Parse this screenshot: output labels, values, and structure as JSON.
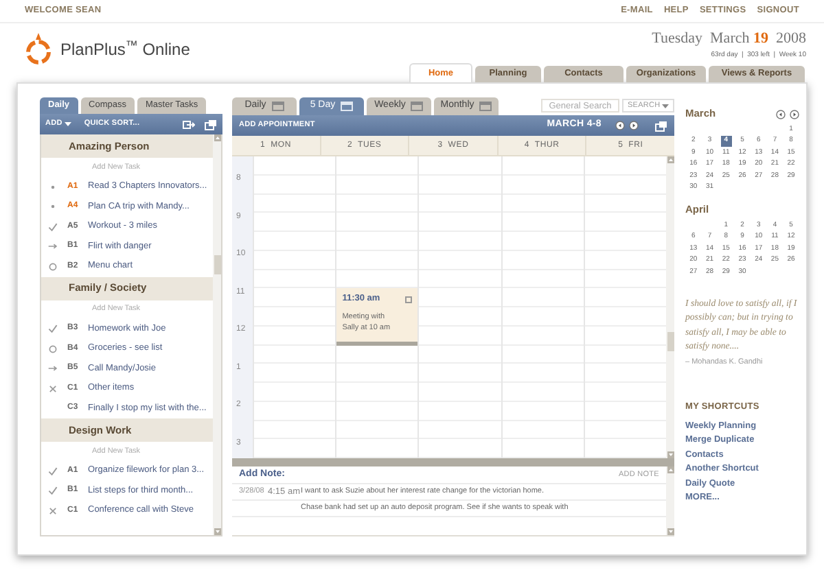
{
  "top_bar": {
    "welcome": "WELCOME SEAN",
    "links": [
      "E-MAIL",
      "HELP",
      "SETTINGS",
      "SIGNOUT"
    ]
  },
  "logo": {
    "text": "PlanPlus$^{™}$ Online"
  },
  "date": {
    "weekday": "Tuesday",
    "month": "March",
    "day": "19",
    "year": "2008",
    "info": "63rd day  |  303 left  |  Week 10"
  },
  "main_tabs": [
    {
      "label": "Home",
      "selected": true
    },
    {
      "label": "Planning",
      "selected": false
    },
    {
      "label": "Contacts",
      "selected": false
    },
    {
      "label": "Organizations",
      "selected": false
    },
    {
      "label": "Views & Reports",
      "selected": false
    }
  ],
  "task_panel": {
    "tabs": [
      {
        "label": "Daily",
        "selected": true
      },
      {
        "label": "Compass",
        "selected": false
      },
      {
        "label": "Master Tasks",
        "selected": false
      }
    ],
    "add": "ADD",
    "quick_sort": "QUICK SORT...",
    "groups": [
      {
        "title": "Amazing Person",
        "add_label": "Add New Task",
        "tasks": [
          {
            "kind": "bullet",
            "priority": "A1",
            "color": "#e06a10",
            "title": "Read 3 Chapters Innovators..."
          },
          {
            "kind": "bullet",
            "priority": "A4",
            "color": "#e06a10",
            "title": "Plan CA trip with Mandy..."
          },
          {
            "kind": "check",
            "priority": "A5",
            "color": "#666666",
            "title": "Workout - 3 miles"
          },
          {
            "kind": "forward",
            "priority": "B1",
            "color": "#666666",
            "title": "Flirt with danger"
          },
          {
            "kind": "open",
            "priority": "B2",
            "color": "#666666",
            "title": "Menu chart"
          }
        ]
      },
      {
        "title": "Family / Society",
        "add_label": "Add New Task",
        "tasks": [
          {
            "kind": "check",
            "priority": "B3",
            "color": "#666666",
            "title": "Homework with Joe"
          },
          {
            "kind": "open",
            "priority": "B4",
            "color": "#666666",
            "title": "Groceries - see list"
          },
          {
            "kind": "forward",
            "priority": "B5",
            "color": "#666666",
            "title": "Call Mandy/Josie"
          },
          {
            "kind": "cancel",
            "priority": "C1",
            "color": "#666666",
            "title": "Other items"
          },
          {
            "kind": "plain",
            "priority": "C3",
            "color": "#666666",
            "title": "Finally I stop my list with the..."
          }
        ]
      },
      {
        "title": "Design Work",
        "add_label": "Add New Task",
        "tasks": [
          {
            "kind": "check",
            "priority": "A1",
            "color": "#666666",
            "title": "Organize filework for plan 3..."
          },
          {
            "kind": "check",
            "priority": "B1",
            "color": "#666666",
            "title": "List steps for third month..."
          },
          {
            "kind": "cancel",
            "priority": "C1",
            "color": "#666666",
            "title": "Conference call with Steve"
          }
        ]
      }
    ]
  },
  "calendar": {
    "tabs": [
      {
        "label": "Daily",
        "selected": false
      },
      {
        "label": "5 Day",
        "selected": true
      },
      {
        "label": "Weekly",
        "selected": false
      },
      {
        "label": "Monthly",
        "selected": false
      }
    ],
    "search": {
      "placeholder": "General Search"
    },
    "search_button": "SEARCH",
    "add": "ADD APPOINTMENT",
    "range": "MARCH 4-8",
    "days": [
      {
        "label": "1  MON"
      },
      {
        "label": "2  TUES",
        "appointments": [
          {
            "time": "11:30 am",
            "text": "Meeting with Sally at 10 am"
          }
        ]
      },
      {
        "label": "3  WED"
      },
      {
        "label": "4  THUR"
      },
      {
        "label": "5  FRI"
      }
    ],
    "hours": [
      "8",
      "9",
      "10",
      "11",
      "12",
      "1",
      "2",
      "3"
    ]
  },
  "notes": {
    "title": "Add Note:",
    "add": "ADD NOTE",
    "entries": [
      {
        "date": "3/28/08",
        "time": "4:15 am",
        "text": "I want to ask Suzie about her interest rate change for the victorian home."
      },
      {
        "text": "Chase bank had set up an auto deposit program. See if she wants to speak with"
      }
    ]
  },
  "mini_calendars": [
    {
      "month": "March",
      "weeks": [
        [
          {
            "kind": "blank"
          },
          {
            "kind": "blank"
          },
          {
            "kind": "blank"
          },
          {
            "kind": "blank"
          },
          {
            "kind": "blank"
          },
          {
            "kind": "blank"
          },
          {
            "kind": "day",
            "day": "1",
            "selected": false
          }
        ],
        [
          {
            "kind": "day",
            "day": "2",
            "selected": false
          },
          {
            "kind": "day",
            "day": "3",
            "selected": false
          },
          {
            "kind": "day",
            "day": "4",
            "selected": true
          },
          {
            "kind": "day",
            "day": "5",
            "selected": false
          },
          {
            "kind": "day",
            "day": "6",
            "selected": false
          },
          {
            "kind": "day",
            "day": "7",
            "selected": false
          },
          {
            "kind": "day",
            "day": "8",
            "selected": false
          }
        ],
        [
          {
            "kind": "day",
            "day": "9",
            "selected": false
          },
          {
            "kind": "day",
            "day": "10",
            "selected": false
          },
          {
            "kind": "day",
            "day": "11",
            "selected": false
          },
          {
            "kind": "day",
            "day": "12",
            "selected": false
          },
          {
            "kind": "day",
            "day": "13",
            "selected": false
          },
          {
            "kind": "day",
            "day": "14",
            "selected": false
          },
          {
            "kind": "day",
            "day": "15",
            "selected": false
          }
        ],
        [
          {
            "kind": "day",
            "day": "16",
            "selected": false
          },
          {
            "kind": "day",
            "day": "17",
            "selected": false
          },
          {
            "kind": "day",
            "day": "18",
            "selected": false
          },
          {
            "kind": "day",
            "day": "19",
            "selected": false
          },
          {
            "kind": "day",
            "day": "20",
            "selected": false
          },
          {
            "kind": "day",
            "day": "21",
            "selected": false
          },
          {
            "kind": "day",
            "day": "22",
            "selected": false
          }
        ],
        [
          {
            "kind": "day",
            "day": "23",
            "selected": false
          },
          {
            "kind": "day",
            "day": "24",
            "selected": false
          },
          {
            "kind": "day",
            "day": "25",
            "selected": false
          },
          {
            "kind": "day",
            "day": "26",
            "selected": false
          },
          {
            "kind": "day",
            "day": "27",
            "selected": false
          },
          {
            "kind": "day",
            "day": "28",
            "selected": false
          },
          {
            "kind": "day",
            "day": "29",
            "selected": false
          }
        ],
        [
          {
            "kind": "day",
            "day": "30",
            "selected": false
          },
          {
            "kind": "day",
            "day": "31",
            "selected": false
          }
        ]
      ]
    },
    {
      "month": "April",
      "weeks": [
        [
          {
            "kind": "blank"
          },
          {
            "kind": "blank"
          },
          {
            "kind": "day",
            "day": "1",
            "selected": false
          },
          {
            "kind": "day",
            "day": "2",
            "selected": false
          },
          {
            "kind": "day",
            "day": "3",
            "selected": false
          },
          {
            "kind": "day",
            "day": "4",
            "selected": false
          },
          {
            "kind": "day",
            "day": "5",
            "selected": false
          }
        ],
        [
          {
            "kind": "day",
            "day": "6",
            "selected": false
          },
          {
            "kind": "day",
            "day": "7",
            "selected": false
          },
          {
            "kind": "day",
            "day": "8",
            "selected": false
          },
          {
            "kind": "day",
            "day": "9",
            "selected": false
          },
          {
            "kind": "day",
            "day": "10",
            "selected": false
          },
          {
            "kind": "day",
            "day": "11",
            "selected": false
          },
          {
            "kind": "day",
            "day": "12",
            "selected": false
          }
        ],
        [
          {
            "kind": "day",
            "day": "13",
            "selected": false
          },
          {
            "kind": "day",
            "day": "14",
            "selected": false
          },
          {
            "kind": "day",
            "day": "15",
            "selected": false
          },
          {
            "kind": "day",
            "day": "16",
            "selected": false
          },
          {
            "kind": "day",
            "day": "17",
            "selected": false
          },
          {
            "kind": "day",
            "day": "18",
            "selected": false
          },
          {
            "kind": "day",
            "day": "19",
            "selected": false
          }
        ],
        [
          {
            "kind": "day",
            "day": "20",
            "selected": false
          },
          {
            "kind": "day",
            "day": "21",
            "selected": false
          },
          {
            "kind": "day",
            "day": "22",
            "selected": false
          },
          {
            "kind": "day",
            "day": "23",
            "selected": false
          },
          {
            "kind": "day",
            "day": "24",
            "selected": false
          },
          {
            "kind": "day",
            "day": "25",
            "selected": false
          },
          {
            "kind": "day",
            "day": "26",
            "selected": false
          }
        ],
        [
          {
            "kind": "day",
            "day": "27",
            "selected": false
          },
          {
            "kind": "day",
            "day": "28",
            "selected": false
          },
          {
            "kind": "day",
            "day": "29",
            "selected": false
          },
          {
            "kind": "day",
            "day": "30",
            "selected": false
          }
        ]
      ]
    }
  ],
  "quote": {
    "text": "I should love to satisfy all, if I possibly can; but in trying to satisfy all, I may be able to satisfy none....",
    "author": "– Mohandas K. Gandhi"
  },
  "shortcuts": {
    "title": "MY SHORTCUTS",
    "items": [
      "Weekly Planning",
      "Merge Duplicate",
      "Contacts",
      "Another Shortcut",
      "Daily Quote",
      "MORE..."
    ]
  }
}
